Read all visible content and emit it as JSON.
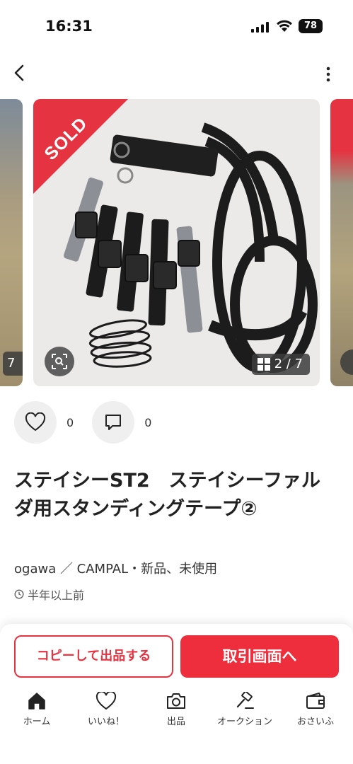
{
  "status_bar": {
    "time": "16:31",
    "battery": "78"
  },
  "gallery": {
    "sold_label": "SOLD",
    "counter": "2 / 7",
    "prev_counter": "7"
  },
  "reactions": {
    "likes": "0",
    "comments": "0"
  },
  "item": {
    "title": "ステイシーST2　ステイシーファルダ用スタンディングテープ②",
    "meta": "ogawa ／ CAMPAL・新品、未使用",
    "posted": "半年以上前"
  },
  "actions": {
    "copy_label": "コピーして出品する",
    "trade_label": "取引画面へ"
  },
  "tabs": [
    {
      "label": "ホーム",
      "icon": "home-icon"
    },
    {
      "label": "いいね！",
      "icon": "heart-icon"
    },
    {
      "label": "出品",
      "icon": "camera-icon"
    },
    {
      "label": "オークション",
      "icon": "gavel-icon"
    },
    {
      "label": "おさいふ",
      "icon": "wallet-icon"
    }
  ],
  "colors": {
    "accent": "#E53341",
    "text": "#222222"
  }
}
